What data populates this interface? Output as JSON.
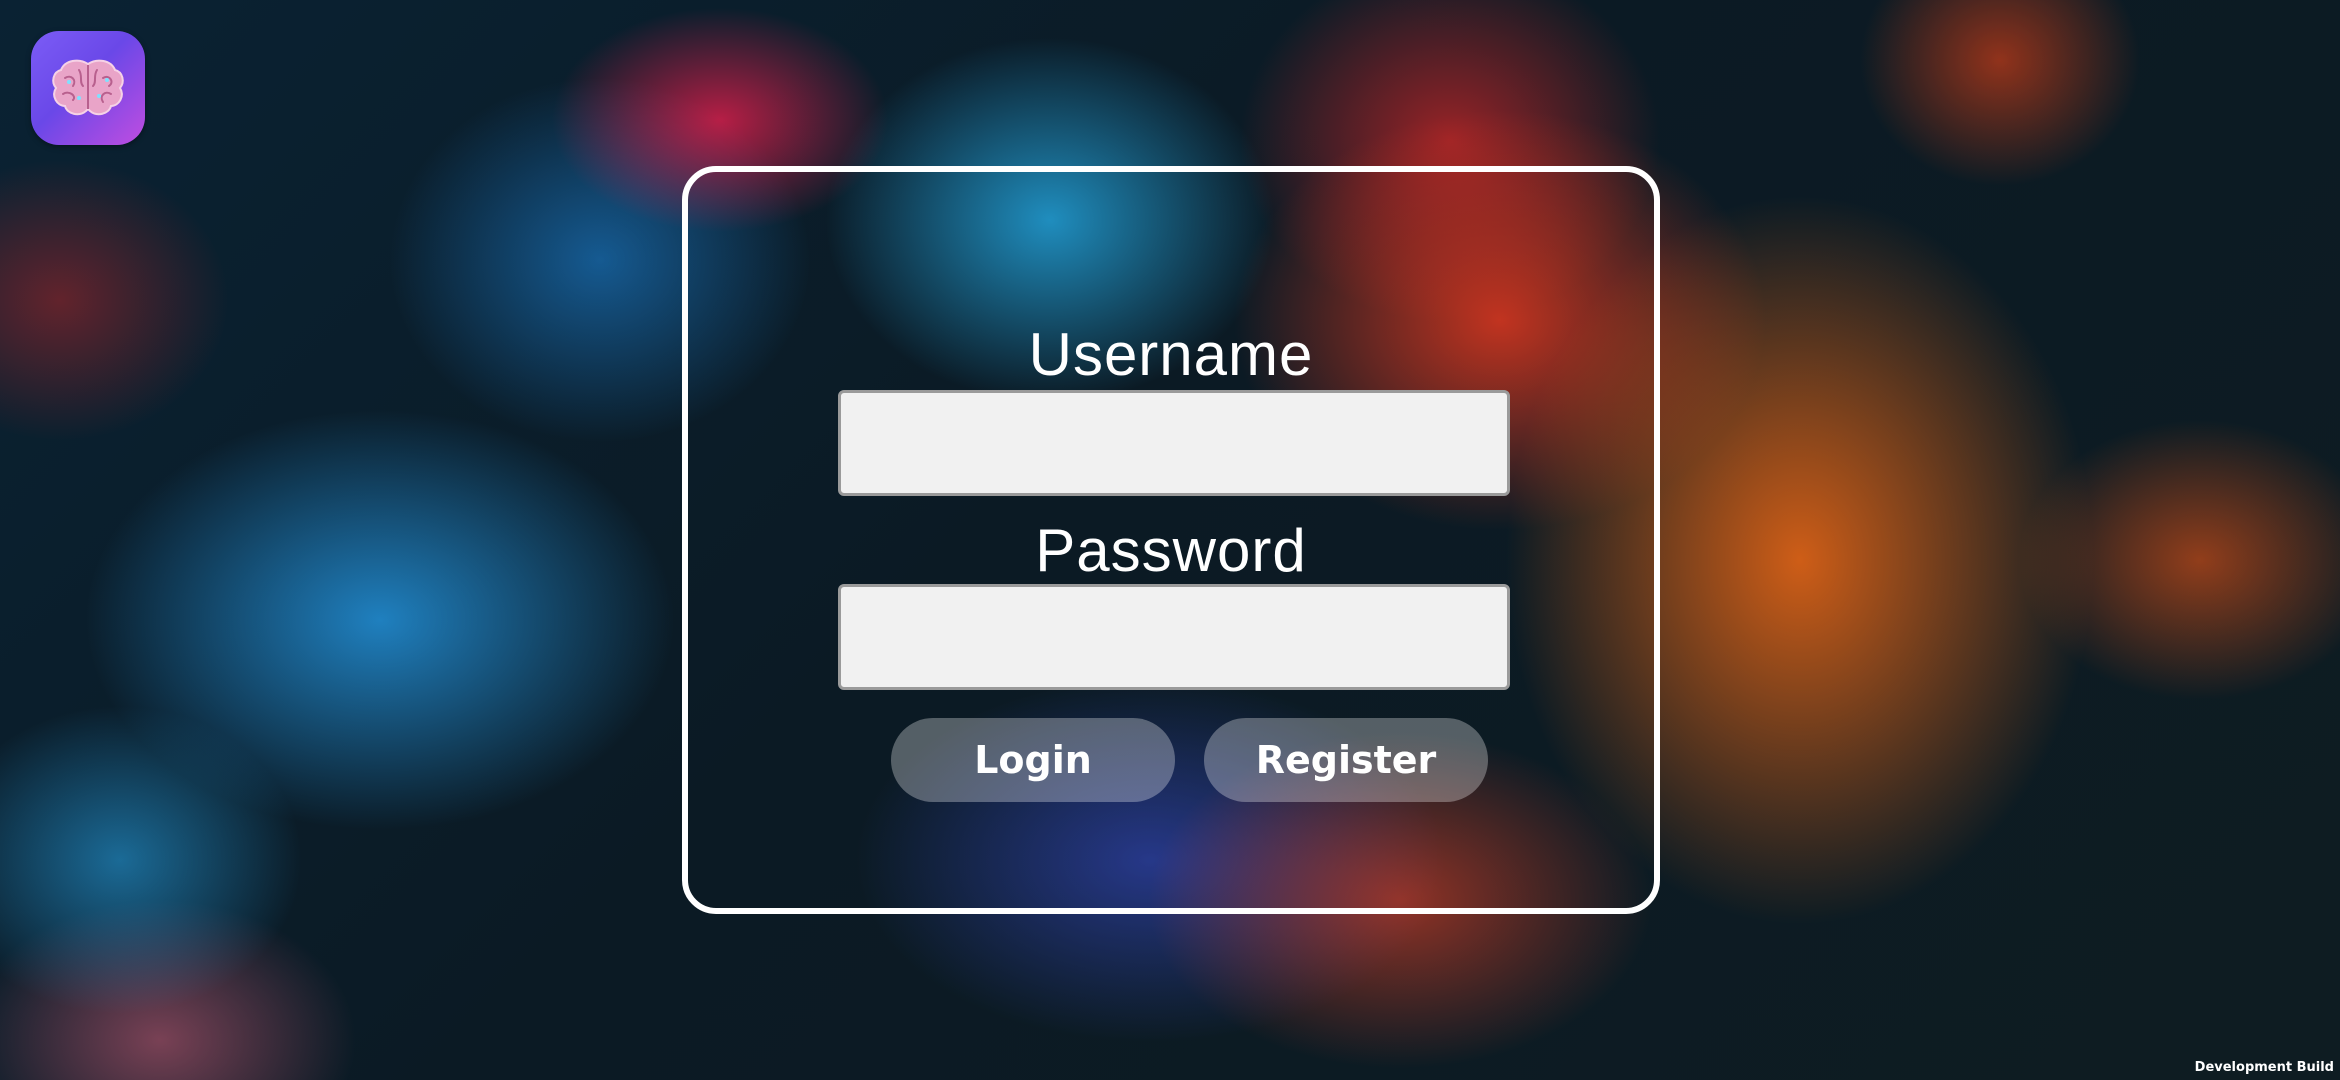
{
  "app": {
    "icon_name": "brain-icon",
    "icon_colors": [
      "#7b5cf6",
      "#c04de0"
    ]
  },
  "login_form": {
    "username_label": "Username",
    "username_value": "",
    "password_label": "Password",
    "password_value": "",
    "login_label": "Login",
    "register_label": "Register"
  },
  "footer": {
    "build_label": "Development Build"
  },
  "colors": {
    "frame_border": "#ffffff",
    "input_background": "#f1f1f1",
    "input_border": "#9a9a9a"
  }
}
